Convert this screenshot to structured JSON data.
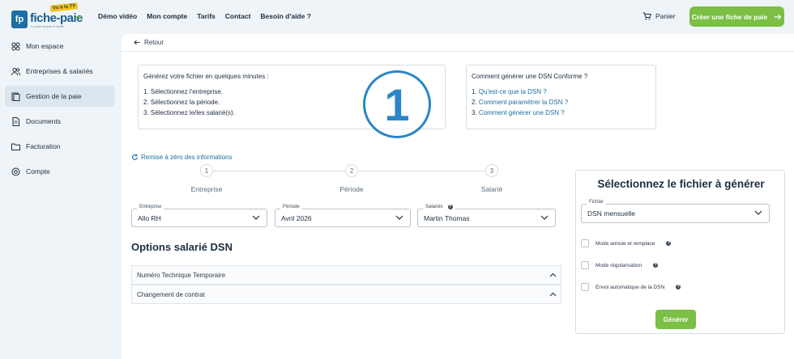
{
  "brand": {
    "name": "fiche-paie",
    "badge": "fp",
    "tv": "Vu à la TV",
    "net": ".net",
    "tagline": "Le paie simple et facile"
  },
  "nav": {
    "items": [
      "Démo vidéo",
      "Mon compte",
      "Tarifs",
      "Contact",
      "Besoin d'aide ?"
    ],
    "cart": "Panier",
    "cta": "Créer une fiche de paie"
  },
  "sidebar": {
    "items": [
      {
        "label": "Mon espace",
        "icon": "grid-icon"
      },
      {
        "label": "Entreprises & salariés",
        "icon": "users-icon"
      },
      {
        "label": "Gestion de la paie",
        "icon": "payslip-icon"
      },
      {
        "label": "Documents",
        "icon": "document-icon"
      },
      {
        "label": "Facturation",
        "icon": "folder-icon"
      },
      {
        "label": "Compte",
        "icon": "gear-icon"
      }
    ],
    "active": "Gestion de la paie"
  },
  "main": {
    "back": "Retour",
    "intro": {
      "title": "Générez votre fichier en quelques minutes :",
      "steps": [
        "1. Sélectionnez l'entreprise.",
        "2. Sélectionnez la période.",
        "3. Sélectionnez le/les salarié(s)."
      ]
    },
    "help": {
      "title": "Comment générer une DSN Conforme ?",
      "prefixes": [
        "1. ",
        "2. ",
        "3. "
      ],
      "links": [
        "Qu'est-ce que la DSN ?",
        "Comment paramétrer la DSN ?",
        "Comment générer une DSN ?"
      ]
    },
    "overlay_number": "1",
    "reset": "Remise à zéro des informations",
    "steps": [
      {
        "num": "1",
        "label": "Entreprise"
      },
      {
        "num": "2",
        "label": "Période"
      },
      {
        "num": "3",
        "label": "Salarié"
      }
    ],
    "selects": {
      "entreprise": {
        "label": "Entreprise",
        "value": "Allo RH"
      },
      "periode": {
        "label": "Période",
        "value": "Avril 2026"
      },
      "salaries": {
        "label": "Salariés",
        "value": "Martin Thomas"
      }
    },
    "options_title": "Options salarié DSN",
    "accordions": [
      "Numéro Technique Temporaire",
      "Changement de contrat"
    ]
  },
  "panel": {
    "title": "Sélectionnez le fichier à générer",
    "fichier": {
      "label": "Fichier",
      "value": "DSN mensuelle"
    },
    "checkboxes": [
      "Mode annule et remplace",
      "Mode régularisation",
      "Envoi automatique de la DSN"
    ],
    "info": "?",
    "button": "Générer"
  },
  "colors": {
    "accent": "#7bbf45",
    "link": "#1c6ea4",
    "circle": "#2a86c8"
  }
}
